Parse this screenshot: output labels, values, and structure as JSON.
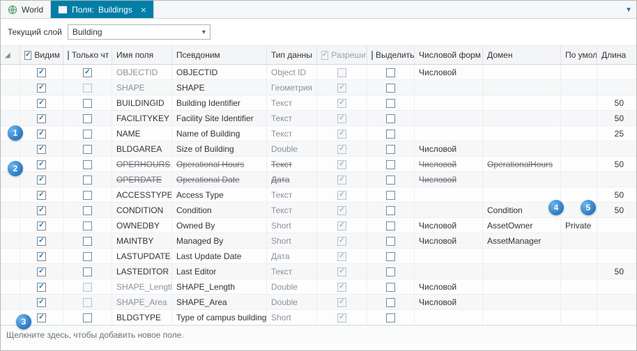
{
  "tabs": {
    "world": "World",
    "fields_prefix": "Поля:",
    "fields_layer": "Buildings"
  },
  "toolbar": {
    "current_layer_label": "Текущий слой",
    "layer_name": "Building"
  },
  "columns": {
    "c0": "",
    "c1": "Видим",
    "c2": "Только чт",
    "c3": "Имя поля",
    "c4": "Псевдоним",
    "c5": "Тип данны",
    "c6": "Разрешить",
    "c7": "Выделить",
    "c8": "Числовой форм",
    "c9": "Домен",
    "c10": "По умол",
    "c11": "Длина"
  },
  "rows": [
    {
      "vis": true,
      "ro": true,
      "roDim": false,
      "name": "OBJECTID",
      "nameGray": true,
      "alias": "OBJECTID",
      "type": "Object ID",
      "typeGray": true,
      "allow": false,
      "allowDim": true,
      "sel": false,
      "numfmt": "Числовой",
      "domain": "",
      "def": "",
      "len": "",
      "strike": false
    },
    {
      "vis": true,
      "ro": false,
      "roDim": true,
      "name": "SHAPE",
      "nameGray": true,
      "alias": "SHAPE",
      "type": "Геометрия",
      "typeGray": true,
      "allow": true,
      "allowDim": true,
      "sel": false,
      "numfmt": "",
      "domain": "",
      "def": "",
      "len": "",
      "strike": false
    },
    {
      "vis": true,
      "ro": false,
      "roDim": false,
      "name": "BUILDINGID",
      "nameGray": false,
      "alias": "Building Identifier",
      "type": "Текст",
      "typeGray": true,
      "allow": true,
      "allowDim": true,
      "sel": false,
      "numfmt": "",
      "domain": "",
      "def": "",
      "len": "50",
      "strike": false
    },
    {
      "vis": true,
      "ro": false,
      "roDim": false,
      "name": "FACILITYKEY",
      "nameGray": false,
      "alias": "Facility Site Identifier",
      "type": "Текст",
      "typeGray": true,
      "allow": true,
      "allowDim": true,
      "sel": false,
      "numfmt": "",
      "domain": "",
      "def": "",
      "len": "50",
      "strike": false
    },
    {
      "vis": true,
      "ro": false,
      "roDim": false,
      "name": "NAME",
      "nameGray": false,
      "alias": "Name of Building",
      "type": "Текст",
      "typeGray": true,
      "allow": true,
      "allowDim": true,
      "sel": false,
      "numfmt": "",
      "domain": "",
      "def": "",
      "len": "25",
      "strike": false
    },
    {
      "vis": true,
      "ro": false,
      "roDim": false,
      "name": "BLDGAREA",
      "nameGray": false,
      "alias": "Size of Building",
      "type": "Double",
      "typeGray": true,
      "allow": true,
      "allowDim": true,
      "sel": false,
      "numfmt": "Числовой",
      "domain": "",
      "def": "",
      "len": "",
      "strike": false
    },
    {
      "vis": true,
      "ro": false,
      "roDim": false,
      "name": "OPERHOURS",
      "nameGray": false,
      "alias": "Operational Hours",
      "type": "Текст",
      "typeGray": true,
      "allow": true,
      "allowDim": true,
      "sel": false,
      "numfmt": "Числовой",
      "domain": "OperationalHours",
      "def": "",
      "len": "50",
      "strike": true
    },
    {
      "vis": true,
      "ro": false,
      "roDim": false,
      "name": "OPERDATE",
      "nameGray": false,
      "alias": "Operational Date",
      "type": "Дата",
      "typeGray": true,
      "allow": true,
      "allowDim": true,
      "sel": false,
      "numfmt": "Числовой",
      "domain": "",
      "def": "",
      "len": "",
      "strike": true
    },
    {
      "vis": true,
      "ro": false,
      "roDim": false,
      "name": "ACCESSTYPE",
      "nameGray": false,
      "alias": "Access Type",
      "type": "Текст",
      "typeGray": true,
      "allow": true,
      "allowDim": true,
      "sel": false,
      "numfmt": "",
      "domain": "",
      "def": "",
      "len": "50",
      "strike": false
    },
    {
      "vis": true,
      "ro": false,
      "roDim": false,
      "name": "CONDITION",
      "nameGray": false,
      "alias": "Condition",
      "type": "Текст",
      "typeGray": true,
      "allow": true,
      "allowDim": true,
      "sel": false,
      "numfmt": "",
      "domain": "Condition",
      "def": "",
      "len": "50",
      "strike": false
    },
    {
      "vis": true,
      "ro": false,
      "roDim": false,
      "name": "OWNEDBY",
      "nameGray": false,
      "alias": "Owned By",
      "type": "Short",
      "typeGray": true,
      "allow": true,
      "allowDim": true,
      "sel": false,
      "numfmt": "Числовой",
      "domain": "AssetOwner",
      "def": "Private",
      "len": "",
      "strike": false
    },
    {
      "vis": true,
      "ro": false,
      "roDim": false,
      "name": "MAINTBY",
      "nameGray": false,
      "alias": "Managed By",
      "type": "Short",
      "typeGray": true,
      "allow": true,
      "allowDim": true,
      "sel": false,
      "numfmt": "Числовой",
      "domain": "AssetManager",
      "def": "",
      "len": "",
      "strike": false
    },
    {
      "vis": true,
      "ro": false,
      "roDim": false,
      "name": "LASTUPDATE",
      "nameGray": false,
      "alias": "Last Update Date",
      "type": "Дата",
      "typeGray": true,
      "allow": true,
      "allowDim": true,
      "sel": false,
      "numfmt": "",
      "domain": "",
      "def": "",
      "len": "",
      "strike": false
    },
    {
      "vis": true,
      "ro": false,
      "roDim": false,
      "name": "LASTEDITOR",
      "nameGray": false,
      "alias": "Last Editor",
      "type": "Текст",
      "typeGray": true,
      "allow": true,
      "allowDim": true,
      "sel": false,
      "numfmt": "",
      "domain": "",
      "def": "",
      "len": "50",
      "strike": false
    },
    {
      "vis": true,
      "ro": false,
      "roDim": true,
      "name": "SHAPE_Length",
      "nameGray": true,
      "alias": "SHAPE_Length",
      "type": "Double",
      "typeGray": true,
      "allow": true,
      "allowDim": true,
      "sel": false,
      "numfmt": "Числовой",
      "domain": "",
      "def": "",
      "len": "",
      "strike": false
    },
    {
      "vis": true,
      "ro": false,
      "roDim": true,
      "name": "SHAPE_Area",
      "nameGray": true,
      "alias": "SHAPE_Area",
      "type": "Double",
      "typeGray": true,
      "allow": true,
      "allowDim": true,
      "sel": false,
      "numfmt": "Числовой",
      "domain": "",
      "def": "",
      "len": "",
      "strike": false
    },
    {
      "vis": true,
      "ro": false,
      "roDim": false,
      "name": "BLDGTYPE",
      "nameGray": false,
      "alias": "Type of campus building",
      "type": "Short",
      "typeGray": true,
      "allow": true,
      "allowDim": true,
      "sel": false,
      "numfmt": "",
      "domain": "",
      "def": "",
      "len": "",
      "strike": false
    }
  ],
  "callouts": {
    "1": "1",
    "2": "2",
    "3": "3",
    "4": "4",
    "5": "5"
  },
  "footer": {
    "add_hint": "Щелкните здесь, чтобы добавить новое поле."
  }
}
